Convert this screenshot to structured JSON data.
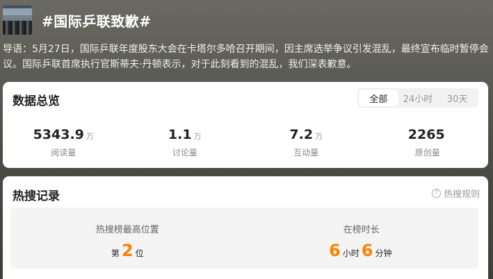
{
  "topic": {
    "title": "#国际乒联致歉#",
    "intro": "导语：5月27日，国际乒联年度股东大会在卡塔尔多哈召开期间，因主席选举争议引发混乱，最终宣布临时暂停会议。国际乒联首席执行官斯蒂夫·丹顿表示，对于此刻看到的混乱，我们深表歉意。"
  },
  "overview": {
    "title": "数据总览",
    "tabs": [
      "全部",
      "24小时",
      "30天"
    ],
    "active_tab": "全部",
    "stats": [
      {
        "value": "5343.9",
        "unit": "万",
        "label": "阅读量"
      },
      {
        "value": "1.1",
        "unit": "万",
        "label": "讨论量"
      },
      {
        "value": "7.2",
        "unit": "万",
        "label": "互动量"
      },
      {
        "value": "2265",
        "unit": "",
        "label": "原创量"
      }
    ]
  },
  "hot_search": {
    "title": "热搜记录",
    "rules_label": "热搜规则",
    "peak": {
      "label": "热搜榜最高位置",
      "prefix": "第",
      "value": "2",
      "suffix": "位"
    },
    "duration": {
      "label": "在榜时长",
      "hours": "6",
      "hours_unit": "小时",
      "minutes": "6",
      "minutes_unit": "分钟"
    }
  },
  "colors": {
    "accent": "#ff8200",
    "card_bg": "#ffffff",
    "panel_bg": "#f4f4f4"
  }
}
